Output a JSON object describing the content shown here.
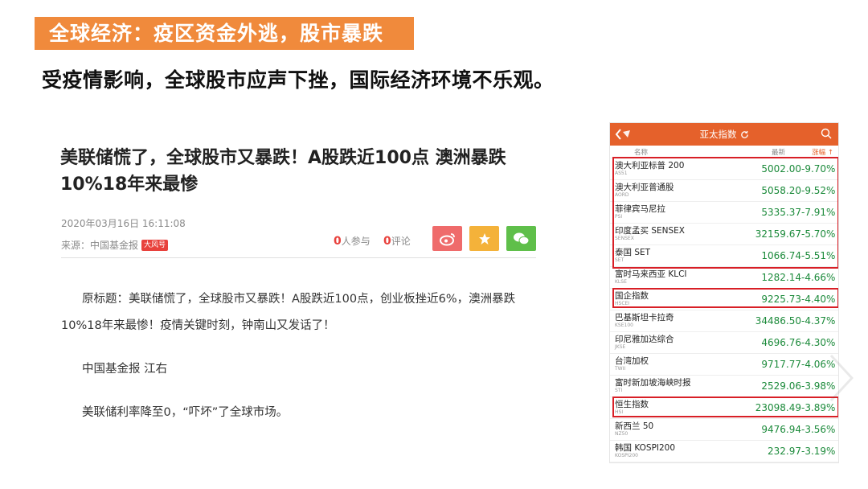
{
  "slide": {
    "title": "全球经济：疫区资金外逃，股市暴跌",
    "subtitle": "受疫情影响，全球股市应声下挫，国际经济环境不乐观。"
  },
  "article": {
    "headline": "美联储慌了，全球股市又暴跌！A股跌近100点 澳洲暴跌10%18年来最惨",
    "date": "2020年03月16日 16:11:08",
    "source": "来源：中国基金报",
    "source_badge": "大风号",
    "participants_count": "0",
    "participants_label": "人参与",
    "comments_count": "0",
    "comments_label": "评论",
    "share_icons": [
      "weibo-icon",
      "star-icon",
      "wechat-icon"
    ],
    "paragraphs": [
      "原标题：美联储慌了，全球股市又暴跌！A股跌近100点，创业板挫近6%，澳洲暴跌10%18年来最惨！疫情关键时刻，钟南山又发话了！",
      "中国基金报 江右",
      "美联储利率降至0，“吓坏”了全球市场。"
    ]
  },
  "market_table": {
    "header_title": "亚太指数",
    "columns": {
      "name": "名称",
      "price": "最新",
      "change": "涨幅"
    },
    "price_color": "#1b8a3a",
    "header_color": "#e5612b",
    "highlight_color": "#d81f26",
    "rows": [
      {
        "name": "澳大利亚标普 200",
        "code": "AS51",
        "price": "5002.00",
        "change": "-9.70%"
      },
      {
        "name": "澳大利亚普通股",
        "code": "AORD",
        "price": "5058.20",
        "change": "-9.52%"
      },
      {
        "name": "菲律宾马尼拉",
        "code": "PSI",
        "price": "5335.37",
        "change": "-7.91%"
      },
      {
        "name": "印度孟买 SENSEX",
        "code": "SENSEX",
        "price": "32159.67",
        "change": "-5.70%"
      },
      {
        "name": "泰国 SET",
        "code": "SET",
        "price": "1066.74",
        "change": "-5.51%"
      },
      {
        "name": "富时马来西亚 KLCI",
        "code": "KLSE",
        "price": "1282.14",
        "change": "-4.66%"
      },
      {
        "name": "国企指数",
        "code": "HSCEI",
        "price": "9225.73",
        "change": "-4.40%"
      },
      {
        "name": "巴基斯坦卡拉奇",
        "code": "KSE100",
        "price": "34486.50",
        "change": "-4.37%"
      },
      {
        "name": "印尼雅加达综合",
        "code": "JKSE",
        "price": "4696.76",
        "change": "-4.30%"
      },
      {
        "name": "台湾加权",
        "code": "TWII",
        "price": "9717.77",
        "change": "-4.06%"
      },
      {
        "name": "富时新加坡海峡时报",
        "code": "STI",
        "price": "2529.06",
        "change": "-3.98%"
      },
      {
        "name": "恒生指数",
        "code": "HSI",
        "price": "23098.49",
        "change": "-3.89%"
      },
      {
        "name": "新西兰 50",
        "code": "NZ50",
        "price": "9476.94",
        "change": "-3.56%"
      },
      {
        "name": "韩国 KOSPI200",
        "code": "KOSPI200",
        "price": "232.97",
        "change": "-3.19%"
      }
    ]
  }
}
